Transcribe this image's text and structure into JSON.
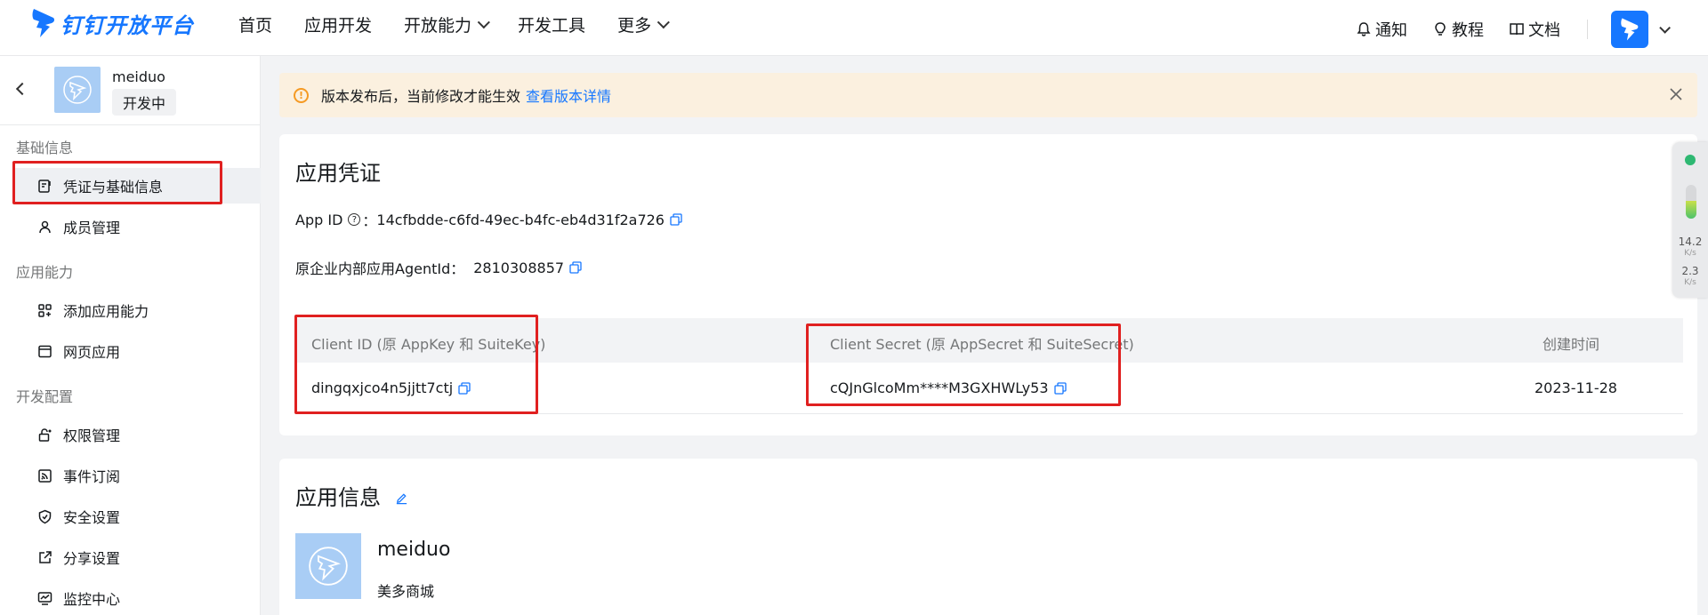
{
  "brand": {
    "logo_text": "钉钉开放平台",
    "accent": "#1677ff",
    "highlight": "#e02020"
  },
  "nav": {
    "items": [
      {
        "label": "首页",
        "has_dropdown": false
      },
      {
        "label": "应用开发",
        "has_dropdown": false
      },
      {
        "label": "开放能力",
        "has_dropdown": true
      },
      {
        "label": "开发工具",
        "has_dropdown": false
      },
      {
        "label": "更多",
        "has_dropdown": true
      }
    ],
    "right": {
      "notify": "通知",
      "tutorial": "教程",
      "docs": "文档"
    }
  },
  "sidebar": {
    "app_name": "meiduo",
    "app_status": "开发中",
    "groups": [
      {
        "label": "基础信息",
        "items": [
          {
            "label": "凭证与基础信息",
            "icon": "credential-icon",
            "active": true
          },
          {
            "label": "成员管理",
            "icon": "user-icon"
          }
        ]
      },
      {
        "label": "应用能力",
        "items": [
          {
            "label": "添加应用能力",
            "icon": "apps-add-icon"
          },
          {
            "label": "网页应用",
            "icon": "webpage-icon"
          }
        ]
      },
      {
        "label": "开发配置",
        "items": [
          {
            "label": "权限管理",
            "icon": "lock-icon"
          },
          {
            "label": "事件订阅",
            "icon": "rss-icon"
          },
          {
            "label": "安全设置",
            "icon": "shield-icon"
          },
          {
            "label": "分享设置",
            "icon": "share-icon"
          },
          {
            "label": "监控中心",
            "icon": "monitor-icon"
          }
        ]
      }
    ]
  },
  "alert": {
    "text": "版本发布后，当前修改才能生效",
    "link": "查看版本详情"
  },
  "credentials": {
    "title": "应用凭证",
    "app_id_label": "App ID",
    "app_id_sep": "：",
    "app_id": "14cfbdde-c6fd-49ec-b4fc-eb4d31f2a726",
    "agent_label": "原企业内部应用AgentId：",
    "agent_id": "2810308857",
    "table": {
      "headers": [
        "Client ID (原 AppKey 和 SuiteKey)",
        "Client Secret (原 AppSecret 和 SuiteSecret)",
        "创建时间"
      ],
      "row": [
        "dingqxjco4n5jjtt7ctj",
        "cQJnGlcoMm****M3GXHWLy53",
        "2023-11-28"
      ]
    }
  },
  "app_info": {
    "title": "应用信息",
    "name": "meiduo",
    "desc": "美多商城"
  },
  "net_widget": {
    "up": "14.2",
    "up_unit": "K/s",
    "down": "2.3",
    "down_unit": "K/s"
  }
}
